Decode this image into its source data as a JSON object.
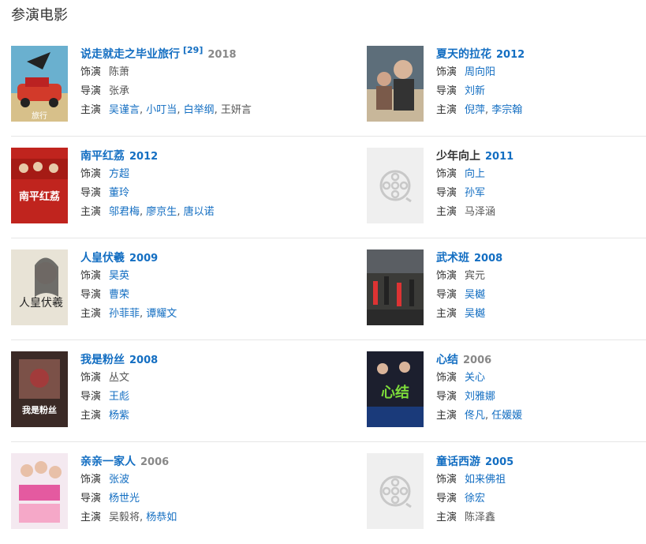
{
  "section": {
    "title": "参演电影"
  },
  "labels": {
    "role": "饰演",
    "director": "导演",
    "star": "主演"
  },
  "films": [
    {
      "title": "说走就走之毕业旅行",
      "title_link": true,
      "cite": "[29]",
      "year": "2018",
      "year_link": false,
      "poster": "travel-car",
      "role": [
        {
          "t": "陈萧",
          "link": false
        }
      ],
      "director": [
        {
          "t": "张承",
          "link": false
        }
      ],
      "stars": [
        {
          "t": "吴谨言",
          "link": true
        },
        {
          "t": "小叮当",
          "link": true
        },
        {
          "t": "白举纲",
          "link": true
        },
        {
          "t": "王妍言",
          "link": false
        }
      ]
    },
    {
      "title": "夏天的拉花",
      "title_link": true,
      "cite": "",
      "year": "2012",
      "year_link": true,
      "poster": "summer",
      "role": [
        {
          "t": "周向阳",
          "link": true
        }
      ],
      "director": [
        {
          "t": "刘新",
          "link": true
        }
      ],
      "stars": [
        {
          "t": "倪萍",
          "link": true
        },
        {
          "t": "李宗翰",
          "link": true
        }
      ]
    },
    {
      "title": "南平红荔",
      "title_link": true,
      "cite": "",
      "year": "2012",
      "year_link": true,
      "poster": "nanping",
      "role": [
        {
          "t": "方超",
          "link": true
        }
      ],
      "director": [
        {
          "t": "董玲",
          "link": true
        }
      ],
      "stars": [
        {
          "t": "邬君梅",
          "link": true
        },
        {
          "t": "廖京生",
          "link": true
        },
        {
          "t": "唐以诺",
          "link": true
        }
      ]
    },
    {
      "title": "少年向上",
      "title_link": false,
      "cite": "",
      "year": "2011",
      "year_link": true,
      "poster": "placeholder",
      "role": [
        {
          "t": "向上",
          "link": true
        }
      ],
      "director": [
        {
          "t": "孙军",
          "link": true
        }
      ],
      "stars": [
        {
          "t": "马泽涵",
          "link": false
        }
      ]
    },
    {
      "title": "人皇伏羲",
      "title_link": true,
      "cite": "",
      "year": "2009",
      "year_link": true,
      "poster": "fuxi",
      "role": [
        {
          "t": "昊英",
          "link": true
        }
      ],
      "director": [
        {
          "t": "曹荣",
          "link": true
        }
      ],
      "stars": [
        {
          "t": "孙菲菲",
          "link": true
        },
        {
          "t": "谭耀文",
          "link": true
        }
      ]
    },
    {
      "title": "武术班",
      "title_link": true,
      "cite": "",
      "year": "2008",
      "year_link": true,
      "poster": "martial",
      "role": [
        {
          "t": "宾元",
          "link": false
        }
      ],
      "director": [
        {
          "t": "吴樾",
          "link": true
        }
      ],
      "stars": [
        {
          "t": "吴樾",
          "link": true
        }
      ]
    },
    {
      "title": "我是粉丝",
      "title_link": true,
      "cite": "",
      "year": "2008",
      "year_link": true,
      "poster": "fans",
      "role": [
        {
          "t": "丛文",
          "link": false
        }
      ],
      "director": [
        {
          "t": "王彪",
          "link": true
        }
      ],
      "stars": [
        {
          "t": "杨紫",
          "link": true
        }
      ]
    },
    {
      "title": "心结",
      "title_link": true,
      "cite": "",
      "year": "2006",
      "year_link": false,
      "poster": "knot",
      "role": [
        {
          "t": "关心",
          "link": true
        }
      ],
      "director": [
        {
          "t": "刘雅娜",
          "link": true
        }
      ],
      "stars": [
        {
          "t": "佟凡",
          "link": true
        },
        {
          "t": "任媛媛",
          "link": true
        }
      ]
    },
    {
      "title": "亲亲一家人",
      "title_link": true,
      "cite": "",
      "year": "2006",
      "year_link": false,
      "poster": "family",
      "role": [
        {
          "t": "张波",
          "link": true
        }
      ],
      "director": [
        {
          "t": "杨世光",
          "link": true
        }
      ],
      "stars": [
        {
          "t": "吴毅将",
          "link": false
        },
        {
          "t": "杨恭如",
          "link": true
        }
      ]
    },
    {
      "title": "童话西游",
      "title_link": true,
      "cite": "",
      "year": "2005",
      "year_link": true,
      "poster": "placeholder",
      "role": [
        {
          "t": "如来佛祖",
          "link": true
        }
      ],
      "director": [
        {
          "t": "徐宏",
          "link": true
        }
      ],
      "stars": [
        {
          "t": "陈泽鑫",
          "link": false
        }
      ]
    }
  ],
  "poster_text": {
    "nanping": "南平红荔",
    "fuxi": "人皇伏羲",
    "fans": "我是粉丝",
    "knot": "心结"
  }
}
